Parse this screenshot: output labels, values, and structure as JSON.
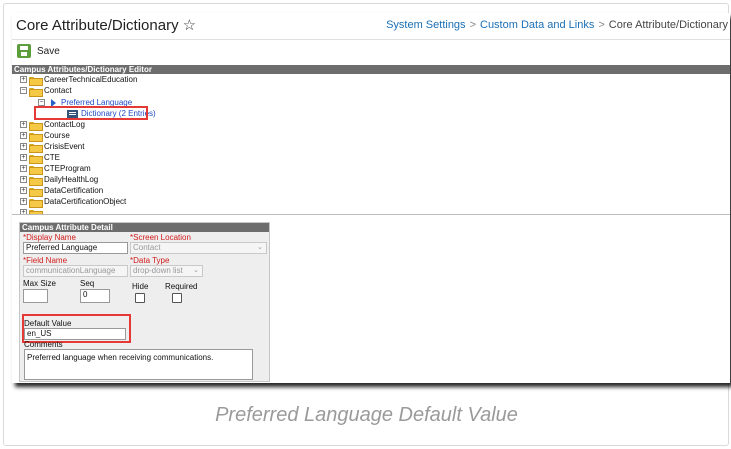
{
  "header": {
    "title": "Core Attribute/Dictionary",
    "breadcrumbs": [
      "System Settings",
      "Custom Data and Links",
      "Core Attribute/Dictionary"
    ]
  },
  "toolbar": {
    "save_label": "Save"
  },
  "tree_panel": {
    "title": "Campus Attributes/Dictionary Editor",
    "items": [
      {
        "label": "CareerTechnicalEducation"
      },
      {
        "label": "Contact"
      },
      {
        "label": "Preferred Language"
      },
      {
        "label": "Dictionary (2 Entries)"
      },
      {
        "label": "ContactLog"
      },
      {
        "label": "Course"
      },
      {
        "label": "CrisisEvent"
      },
      {
        "label": "CTE"
      },
      {
        "label": "CTEProgram"
      },
      {
        "label": "DailyHealthLog"
      },
      {
        "label": "DataCertification"
      },
      {
        "label": "DataCertificationObject"
      }
    ]
  },
  "detail_panel": {
    "title": "Campus Attribute Detail",
    "display_name_label": "*Display Name",
    "display_name_value": "Preferred Language",
    "screen_location_label": "*Screen Location",
    "screen_location_value": "Contact",
    "field_name_label": "*Field Name",
    "field_name_value": "communicationLanguage",
    "data_type_label": "*Data Type",
    "data_type_value": "drop-down list",
    "max_size_label": "Max Size",
    "max_size_value": "",
    "seq_label": "Seq",
    "seq_value": "0",
    "hide_label": "Hide",
    "required_label": "Required",
    "default_value_label": "Default Value",
    "default_value": "en_US",
    "comments_label": "Comments",
    "comments_value": "Preferred language when receiving communications."
  },
  "caption": "Preferred Language Default Value"
}
